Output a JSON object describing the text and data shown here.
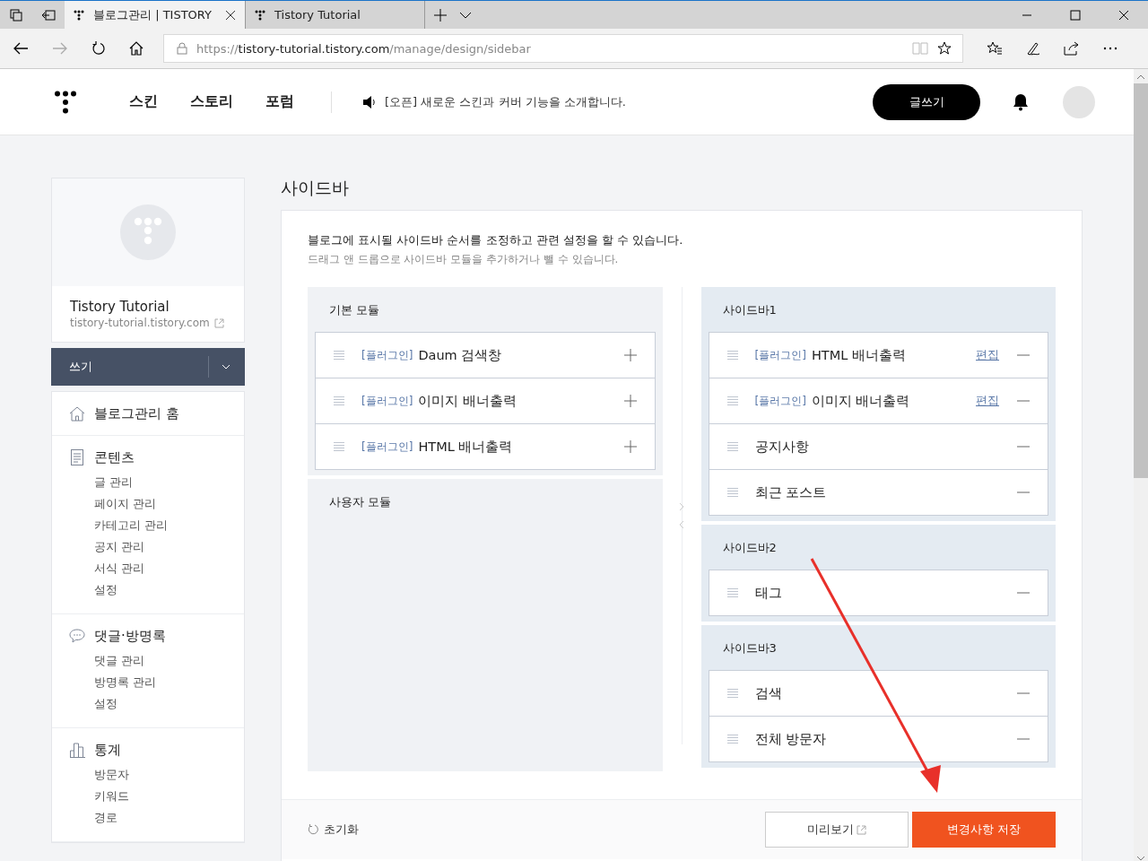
{
  "browser": {
    "tabs": [
      {
        "title": "블로그관리 | TISTORY",
        "selected": true
      },
      {
        "title": "Tistory Tutorial",
        "selected": false
      }
    ],
    "url": {
      "scheme": "https://",
      "host": "tistory-tutorial.tistory.com",
      "path": "/manage/design/sidebar"
    }
  },
  "header": {
    "nav": [
      "스킨",
      "스토리",
      "포럼"
    ],
    "notice": "[오픈] 새로운 스킨과 커버 기능을 소개합니다.",
    "write_button": "글쓰기"
  },
  "sidebar": {
    "blog_name": "Tistory Tutorial",
    "blog_url": "tistory-tutorial.tistory.com",
    "write_menu": "쓰기",
    "groups": [
      {
        "kind": "home",
        "title": "블로그관리 홈"
      },
      {
        "kind": "document",
        "title": "콘텐츠",
        "items": [
          "글 관리",
          "페이지 관리",
          "카테고리 관리",
          "공지 관리",
          "서식 관리",
          "설정"
        ]
      },
      {
        "kind": "comment",
        "title": "댓글·방명록",
        "items": [
          "댓글 관리",
          "방명록 관리",
          "설정"
        ]
      },
      {
        "kind": "chart",
        "title": "통계",
        "items": [
          "방문자",
          "키워드",
          "경로"
        ]
      }
    ]
  },
  "main": {
    "title": "사이드바",
    "description": "블로그에 표시될 사이드바 순서를 조정하고 관련 설정을 할 수 있습니다.",
    "hint": "드래그 앤 드롭으로 사이드바 모듈을 추가하거나 뺄 수 있습니다.",
    "basic_modules": {
      "title": "기본 모듈",
      "items": [
        {
          "tag": "[플러그인]",
          "name": "Daum 검색창"
        },
        {
          "tag": "[플러그인]",
          "name": "이미지 배너출력"
        },
        {
          "tag": "[플러그인]",
          "name": "HTML 배너출력"
        }
      ]
    },
    "user_modules": {
      "title": "사용자 모듈"
    },
    "sidebars": [
      {
        "title": "사이드바1",
        "items": [
          {
            "tag": "[플러그인]",
            "name": "HTML 배너출력",
            "edit": "편집"
          },
          {
            "tag": "[플러그인]",
            "name": "이미지 배너출력",
            "edit": "편집"
          },
          {
            "name": "공지사항"
          },
          {
            "name": "최근 포스트"
          }
        ]
      },
      {
        "title": "사이드바2",
        "items": [
          {
            "name": "태그"
          }
        ]
      },
      {
        "title": "사이드바3",
        "items": [
          {
            "name": "검색"
          },
          {
            "name": "전체 방문자"
          }
        ]
      }
    ],
    "footer": {
      "reset": "초기화",
      "preview": "미리보기",
      "save": "변경사항 저장"
    }
  }
}
